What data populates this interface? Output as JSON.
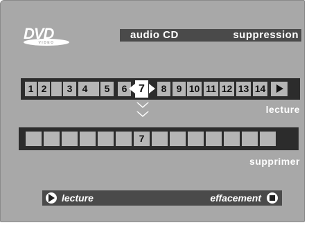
{
  "logo": {
    "name": "DVD VIDEO",
    "main": "DVD",
    "sub": "VIDEO"
  },
  "header": {
    "left": "audio CD",
    "right": "suppression"
  },
  "tracks": [
    "1",
    "2",
    "3",
    "4",
    "5",
    "6",
    "7",
    "8",
    "9",
    "10",
    "11",
    "12",
    "13",
    "14"
  ],
  "selected_track": "7",
  "play_label": "lecture",
  "delete_label": "supprimer",
  "delete_slots": [
    "",
    "",
    "",
    "",
    "",
    "",
    "7",
    "",
    "",
    "",
    "",
    "",
    "",
    ""
  ],
  "footer": {
    "left": "lecture",
    "right": "effacement"
  },
  "colors": {
    "screen_bg": "#a8a8a8",
    "bar_bg": "#4a4a4a",
    "strip_bg": "#2c2c2c",
    "cell_bg": "#b5b5b5"
  }
}
